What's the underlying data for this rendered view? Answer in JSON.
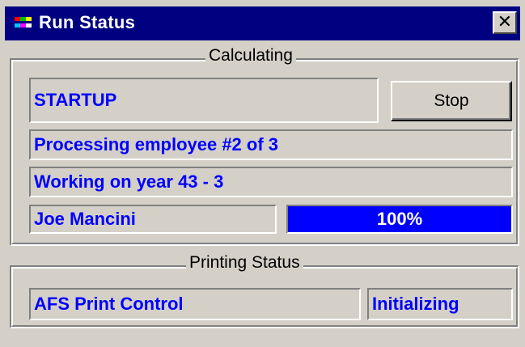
{
  "window": {
    "title": "Run Status",
    "close_label": "✕",
    "icon": "app-icon"
  },
  "calculating": {
    "group_label": "Calculating",
    "phase": "STARTUP",
    "stop_label": "Stop",
    "employee_status": "Processing employee #2 of 3",
    "year_status": "Working on year 43 - 3",
    "employee_name": "Joe Mancini",
    "progress_label": "100%",
    "progress_value": 1.0
  },
  "printing": {
    "group_label": "Printing Status",
    "component": "AFS Print Control",
    "state": "Initializing"
  },
  "colors": {
    "titlebar": "#000080",
    "field_text": "#0000ff",
    "progress_fill": "#0000ff",
    "face": "#d4d0c8"
  }
}
